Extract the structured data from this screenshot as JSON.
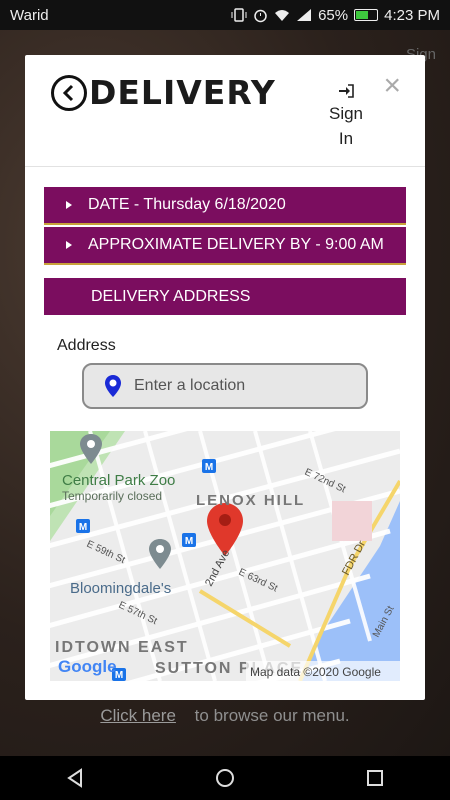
{
  "status_bar": {
    "carrier": "Warid",
    "battery": "65%",
    "time": "4:23 PM",
    "battery_level": 0.65
  },
  "background": {
    "sign_in_ghost": "Sign",
    "browse_link": "Click here",
    "browse_text": "to browse our menu."
  },
  "modal": {
    "title": "DELIVERY",
    "sign_in_line1": "Sign",
    "sign_in_line2": "In",
    "close_symbol": "×",
    "date_bar": "DATE - Thursday 6/18/2020",
    "approx_bar": "APPROXIMATE DELIVERY BY - 9:00 AM",
    "address_header": "DELIVERY ADDRESS",
    "address_label": "Address",
    "location_placeholder": "Enter a location",
    "accent_color": "#7b0d5f"
  },
  "map": {
    "labels": {
      "zoo": "Central Park Zoo",
      "zoo_status": "Temporarily closed",
      "lenox_hill": "LENOX HILL",
      "bloomingdales": "Bloomingdale's",
      "midtown_east": "IDTOWN EAST",
      "sutton_place": "SUTTON PLACE",
      "fdr": "FDR Dr",
      "e72": "E 72nd St",
      "e63": "E 63rd St",
      "e59": "E 59th St",
      "e57": "E 57th St",
      "ave2": "2nd Ave",
      "main_st": "Main St",
      "attribution": "Map data ©2020 Google",
      "google": "Google"
    },
    "icons": [
      "subway-icon",
      "park-icon",
      "shopping-pin-icon",
      "location-marker-icon"
    ]
  },
  "nav": {
    "back": "back-triangle-icon",
    "home": "home-circle-icon",
    "recents": "recents-square-icon"
  }
}
